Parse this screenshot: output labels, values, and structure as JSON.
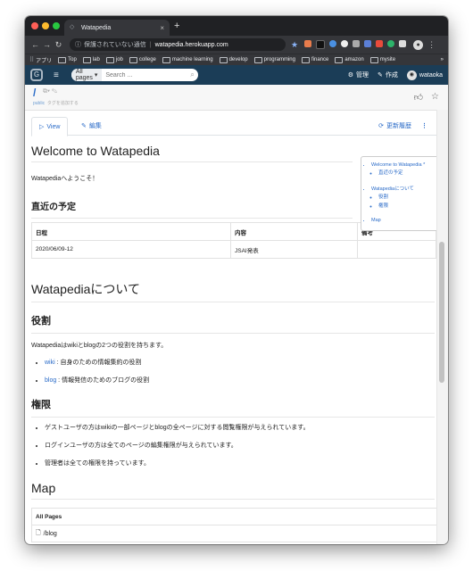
{
  "browser": {
    "tab_title": "Watapedia",
    "tab_close": "×",
    "new_tab": "+",
    "security_label": "保護されていない通信",
    "url": "watapedia.herokuapp.com",
    "bookmarks": [
      "アプリ",
      "Top",
      "lab",
      "job",
      "college",
      "machine learning",
      "develop",
      "programming",
      "finance",
      "amazon",
      "mysite"
    ],
    "bookmarks_more": "»"
  },
  "navbar": {
    "scope_label": "All pages",
    "search_placeholder": "Search ...",
    "admin_label": "管理",
    "create_label": "作成",
    "user_name": "wataoka"
  },
  "page_header": {
    "path": "/",
    "visibility": "public",
    "tag_hint": "タグを追加する"
  },
  "tabs": {
    "view_label": "View",
    "edit_label": "編集",
    "history_label": "更新履歴",
    "more_label": "⋮"
  },
  "article": {
    "title": "Welcome to Watapedia",
    "intro": "Watapediaへようこそ！",
    "schedule_heading": "直近の予定",
    "schedule_table": {
      "headers": [
        "日程",
        "内容",
        "備考"
      ],
      "rows": [
        [
          "2020/06/09-12",
          "JSAI発表",
          ""
        ]
      ]
    },
    "about_heading": "Watapediaについて",
    "roles_heading": "役割",
    "roles_text": "Watapediaはwikiとblogの2つの役割を持ちます。",
    "roles_items": [
      {
        "link": "wiki",
        "text": " : 自身のための情報集約の役割"
      },
      {
        "link": "blog",
        "text": " : 情報発信のためのブログの役割"
      }
    ],
    "perm_heading": "権限",
    "perm_items": [
      "ゲストユーザの方はwikiの一部ページとblogの全ページに対する閲覧権限が与えられています。",
      "ログインユーザの方は全てのページの編集権限が与えられています。",
      "管理者は全ての権限を持っています。"
    ],
    "map_heading": "Map",
    "all_pages_label": "All Pages",
    "first_page": "/blog"
  },
  "toc": {
    "items": [
      {
        "label": "Welcome to Watapedia *",
        "children": [
          "直近の予定"
        ]
      },
      {
        "label": "Watapediaについて",
        "children": [
          "役割",
          "権限"
        ]
      },
      {
        "label": "Map",
        "children": []
      }
    ]
  },
  "colors": {
    "navbar": "#1b3d57",
    "link": "#2a6bc8",
    "chrome_dark": "#202124"
  }
}
